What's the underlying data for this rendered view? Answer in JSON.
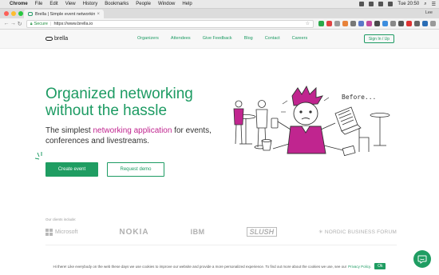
{
  "menubar": {
    "items": [
      "Chrome",
      "File",
      "Edit",
      "View",
      "History",
      "Bookmarks",
      "People",
      "Window",
      "Help"
    ],
    "clock": "Tue 20:50"
  },
  "browser": {
    "tab_title": "Brella | Simple event networkin",
    "user": "Lee",
    "secure_label": "Secure",
    "url": "https://www.brella.io"
  },
  "header": {
    "logo": "brella",
    "nav": [
      "Organizers",
      "Attendees",
      "Give Feedback",
      "Blog",
      "Contact",
      "Careers"
    ],
    "signin": "Sign In / Up"
  },
  "hero": {
    "title_line1": "Organized networking",
    "title_line2": "without the hassle",
    "sub_pre": "The simplest ",
    "sub_highlight": "networking application",
    "sub_post": " for events, conferences and livestreams.",
    "primary_button": "Create event",
    "secondary_button": "Request demo",
    "sketch_caption": "Before..."
  },
  "clients": {
    "label": "Our clients include:",
    "logos": [
      "Microsoft",
      "NOKIA",
      "IBM",
      "SLUSH",
      "NORDIC BUSINESS FORUM"
    ]
  },
  "cookie": {
    "text": "Hi there! Like everybody on the web these days we use cookies to improve our website and provide a more personalized experience. To find out more about the cookies we use, see our",
    "link": "Privacy Policy.",
    "ok": "Ok"
  },
  "colors": {
    "brand_green": "#1d9b63",
    "accent_magenta": "#c0258f"
  }
}
